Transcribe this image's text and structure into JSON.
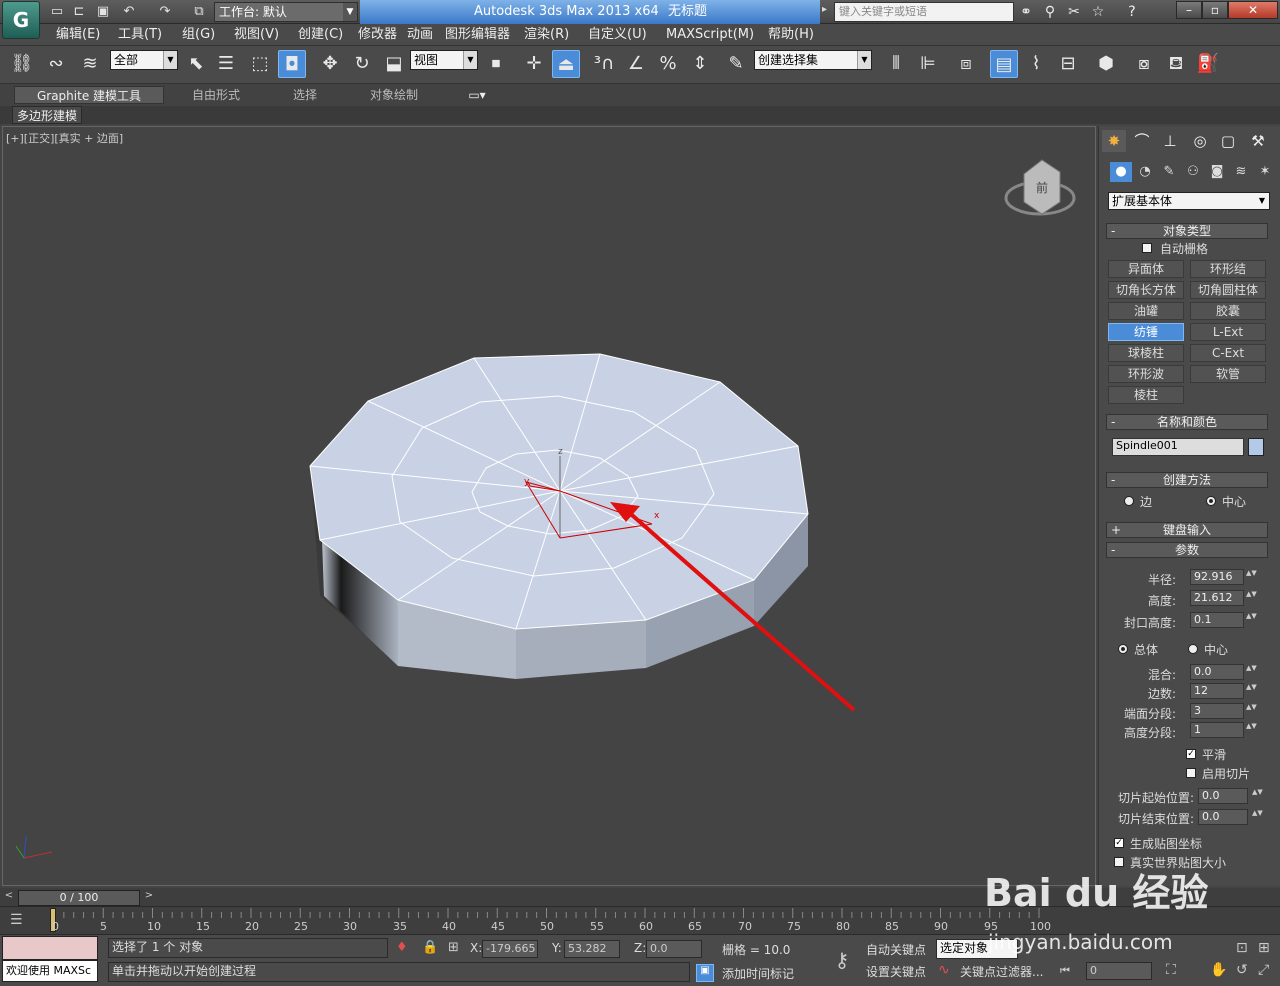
{
  "window": {
    "logo": "G",
    "workspace_label": "工作台: 默认",
    "title": "Autodesk 3ds Max  2013 x64",
    "doc_title": "无标题",
    "search_placeholder": "键入关键字或短语",
    "minimize": "–",
    "restore": "▫",
    "close": "✕"
  },
  "menu": [
    "编辑(E)",
    "工具(T)",
    "组(G)",
    "视图(V)",
    "创建(C)",
    "修改器",
    "动画",
    "图形编辑器",
    "渲染(R)",
    "自定义(U)",
    "MAXScript(M)",
    "帮助(H)"
  ],
  "toolbar": {
    "selection_filter": "全部",
    "ref_coord": "视图",
    "named_selection": "创建选择集"
  },
  "ribbon": {
    "tabs": [
      "Graphite 建模工具",
      "自由形式",
      "选择",
      "对象绘制"
    ],
    "sub_label": "多边形建模"
  },
  "viewport": {
    "label": "[+][正交][真实 + 边面]",
    "viewcube_face": "前",
    "axis_x": "x",
    "axis_y": "y",
    "axis_z": "z"
  },
  "command_panel": {
    "category": "扩展基本体",
    "object_type": {
      "title": "对象类型",
      "autogrid": "自动栅格",
      "buttons": [
        "异面体",
        "环形结",
        "切角长方体",
        "切角圆柱体",
        "油罐",
        "胶囊",
        "纺锤",
        "L-Ext",
        "球棱柱",
        "C-Ext",
        "环形波",
        "软管",
        "棱柱"
      ],
      "active": "纺锤"
    },
    "name_color": {
      "title": "名称和颜色",
      "name": "Spindle001",
      "color": "#b4c8e8"
    },
    "creation_method": {
      "title": "创建方法",
      "opt1": "边",
      "opt2": "中心",
      "selected": "中心"
    },
    "keyboard_entry": "键盘输入",
    "params": {
      "title": "参数",
      "radius_label": "半径:",
      "radius": "92.916",
      "height_label": "高度:",
      "height": "21.612",
      "cap_label": "封口高度:",
      "cap": "0.1",
      "blend_opt1": "总体",
      "blend_opt2": "中心",
      "blend_label": "混合:",
      "blend": "0.0",
      "sides_label": "边数:",
      "sides": "12",
      "cap_segs_label": "端面分段:",
      "cap_segs": "3",
      "height_segs_label": "高度分段:",
      "height_segs": "1",
      "smooth": "平滑",
      "slice_on": "启用切片",
      "slice_from_label": "切片起始位置:",
      "slice_from": "0.0",
      "slice_to_label": "切片结束位置:",
      "slice_to": "0.0",
      "gen_map": "生成贴图坐标",
      "real_world": "真实世界贴图大小"
    }
  },
  "timeline": {
    "frame": "0 / 100",
    "ticks": [
      "0",
      "5",
      "10",
      "15",
      "20",
      "25",
      "30",
      "35",
      "40",
      "45",
      "50",
      "55",
      "60",
      "65",
      "70",
      "75",
      "80",
      "85",
      "90",
      "95",
      "100"
    ]
  },
  "status": {
    "welcome": "欢迎使用 MAXSc",
    "selected": "选择了 1 个 对象",
    "prompt": "单击并拖动以开始创建过程",
    "x_label": "X:",
    "x": "-179.665",
    "y_label": "Y:",
    "y": "53.282",
    "z_label": "Z:",
    "z": "0.0",
    "grid": "栅格 = 10.0",
    "add_time_tag": "添加时间标记",
    "auto_key": "自动关键点",
    "set_key": "设置关键点",
    "key_mode": "选定对象",
    "key_filters": "关键点过滤器...",
    "frame_field": "0"
  },
  "watermark": {
    "line1": "Bai du 经验",
    "line2": "jingyan.baidu.com"
  }
}
